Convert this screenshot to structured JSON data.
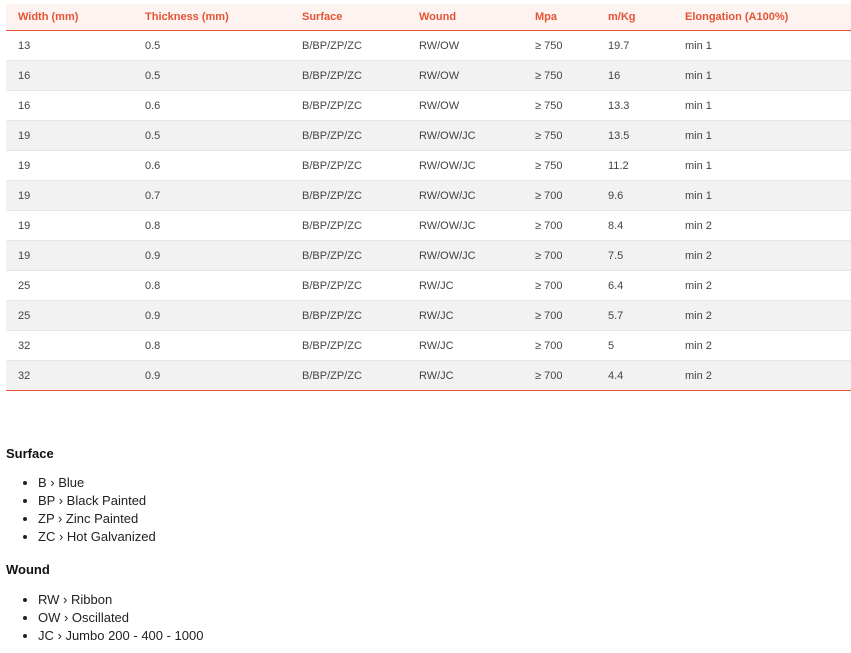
{
  "table": {
    "headers": [
      "Width (mm)",
      "Thickness (mm)",
      "Surface",
      "Wound",
      "Mpa",
      "m/Kg",
      "Elongation (A100%)"
    ],
    "rows": [
      [
        "13",
        "0.5",
        "B/BP/ZP/ZC",
        "RW/OW",
        "≥ 750",
        "19.7",
        "min 1"
      ],
      [
        "16",
        "0.5",
        "B/BP/ZP/ZC",
        "RW/OW",
        "≥ 750",
        "16",
        "min 1"
      ],
      [
        "16",
        "0.6",
        "B/BP/ZP/ZC",
        "RW/OW",
        "≥ 750",
        "13.3",
        "min 1"
      ],
      [
        "19",
        "0.5",
        "B/BP/ZP/ZC",
        "RW/OW/JC",
        "≥ 750",
        "13.5",
        "min 1"
      ],
      [
        "19",
        "0.6",
        "B/BP/ZP/ZC",
        "RW/OW/JC",
        "≥ 750",
        "11.2",
        "min 1"
      ],
      [
        "19",
        "0.7",
        "B/BP/ZP/ZC",
        "RW/OW/JC",
        "≥ 700",
        "9.6",
        "min 1"
      ],
      [
        "19",
        "0.8",
        "B/BP/ZP/ZC",
        "RW/OW/JC",
        "≥ 700",
        "8.4",
        "min 2"
      ],
      [
        "19",
        "0.9",
        "B/BP/ZP/ZC",
        "RW/OW/JC",
        "≥ 700",
        "7.5",
        "min 2"
      ],
      [
        "25",
        "0.8",
        "B/BP/ZP/ZC",
        "RW/JC",
        "≥ 700",
        "6.4",
        "min 2"
      ],
      [
        "25",
        "0.9",
        "B/BP/ZP/ZC",
        "RW/JC",
        "≥ 700",
        "5.7",
        "min 2"
      ],
      [
        "32",
        "0.8",
        "B/BP/ZP/ZC",
        "RW/JC",
        "≥ 700",
        "5",
        "min 2"
      ],
      [
        "32",
        "0.9",
        "B/BP/ZP/ZC",
        "RW/JC",
        "≥ 700",
        "4.4",
        "min 2"
      ]
    ]
  },
  "legend": {
    "surface": {
      "title": "Surface",
      "items": [
        "B › Blue",
        "BP › Black Painted",
        "ZP › Zinc Painted",
        "ZC › Hot Galvanized"
      ]
    },
    "wound": {
      "title": "Wound",
      "items": [
        "RW › Ribbon",
        "OW › Oscillated",
        "JC › Jumbo 200 - 400 - 1000"
      ]
    }
  },
  "colors": {
    "accent": "#e55334",
    "header_bg": "#fdf4f1",
    "stripe_bg": "#f2f2f2"
  }
}
